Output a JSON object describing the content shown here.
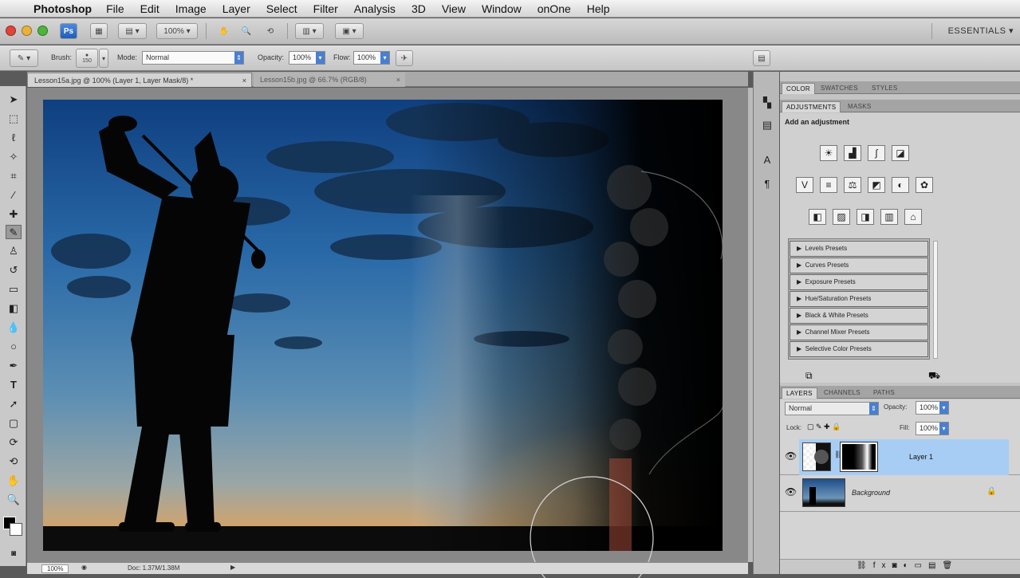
{
  "menubar": {
    "apple_glyph": "",
    "app_name": "Photoshop",
    "items": [
      "File",
      "Edit",
      "Image",
      "Layer",
      "Select",
      "Filter",
      "Analysis",
      "3D",
      "View",
      "Window",
      "onOne",
      "Help"
    ]
  },
  "appbar": {
    "zoom": "100%",
    "workspace": "ESSENTIALS ▾"
  },
  "options": {
    "brush_label": "Brush:",
    "brush_size": "150",
    "mode_label": "Mode:",
    "mode_value": "Normal",
    "opacity_label": "Opacity:",
    "opacity_value": "100%",
    "flow_label": "Flow:",
    "flow_value": "100%"
  },
  "doc_tabs": [
    {
      "label": "Lesson15a.jpg @ 100% (Layer 1, Layer Mask/8) *",
      "close": "×"
    },
    {
      "label": "Lesson15b.jpg @ 66.7% (RGB/8)",
      "close": "×"
    }
  ],
  "status": {
    "zoom": "100%",
    "doc": "Doc: 1.37M/1.38M"
  },
  "panels": {
    "top_tabs": [
      "COLOR",
      "SWATCHES",
      "STYLES"
    ],
    "adj_tabs": [
      "ADJUSTMENTS",
      "MASKS"
    ],
    "add_adjustment": "Add an adjustment",
    "presets": [
      "Levels Presets",
      "Curves Presets",
      "Exposure Presets",
      "Hue/Saturation Presets",
      "Black & White Presets",
      "Channel Mixer Presets",
      "Selective Color Presets"
    ],
    "layer_tabs": [
      "LAYERS",
      "CHANNELS",
      "PATHS"
    ],
    "blend_mode": "Normal",
    "opacity_label": "Opacity:",
    "opacity_value": "100%",
    "lock_label": "Lock:",
    "fill_label": "Fill:",
    "fill_value": "100%",
    "layers": [
      {
        "name": "Layer 1",
        "selected": true
      },
      {
        "name": "Background",
        "selected": false
      }
    ]
  },
  "colors": {
    "accent": "#4a7fd0",
    "selected_layer": "#a8cdf4"
  }
}
